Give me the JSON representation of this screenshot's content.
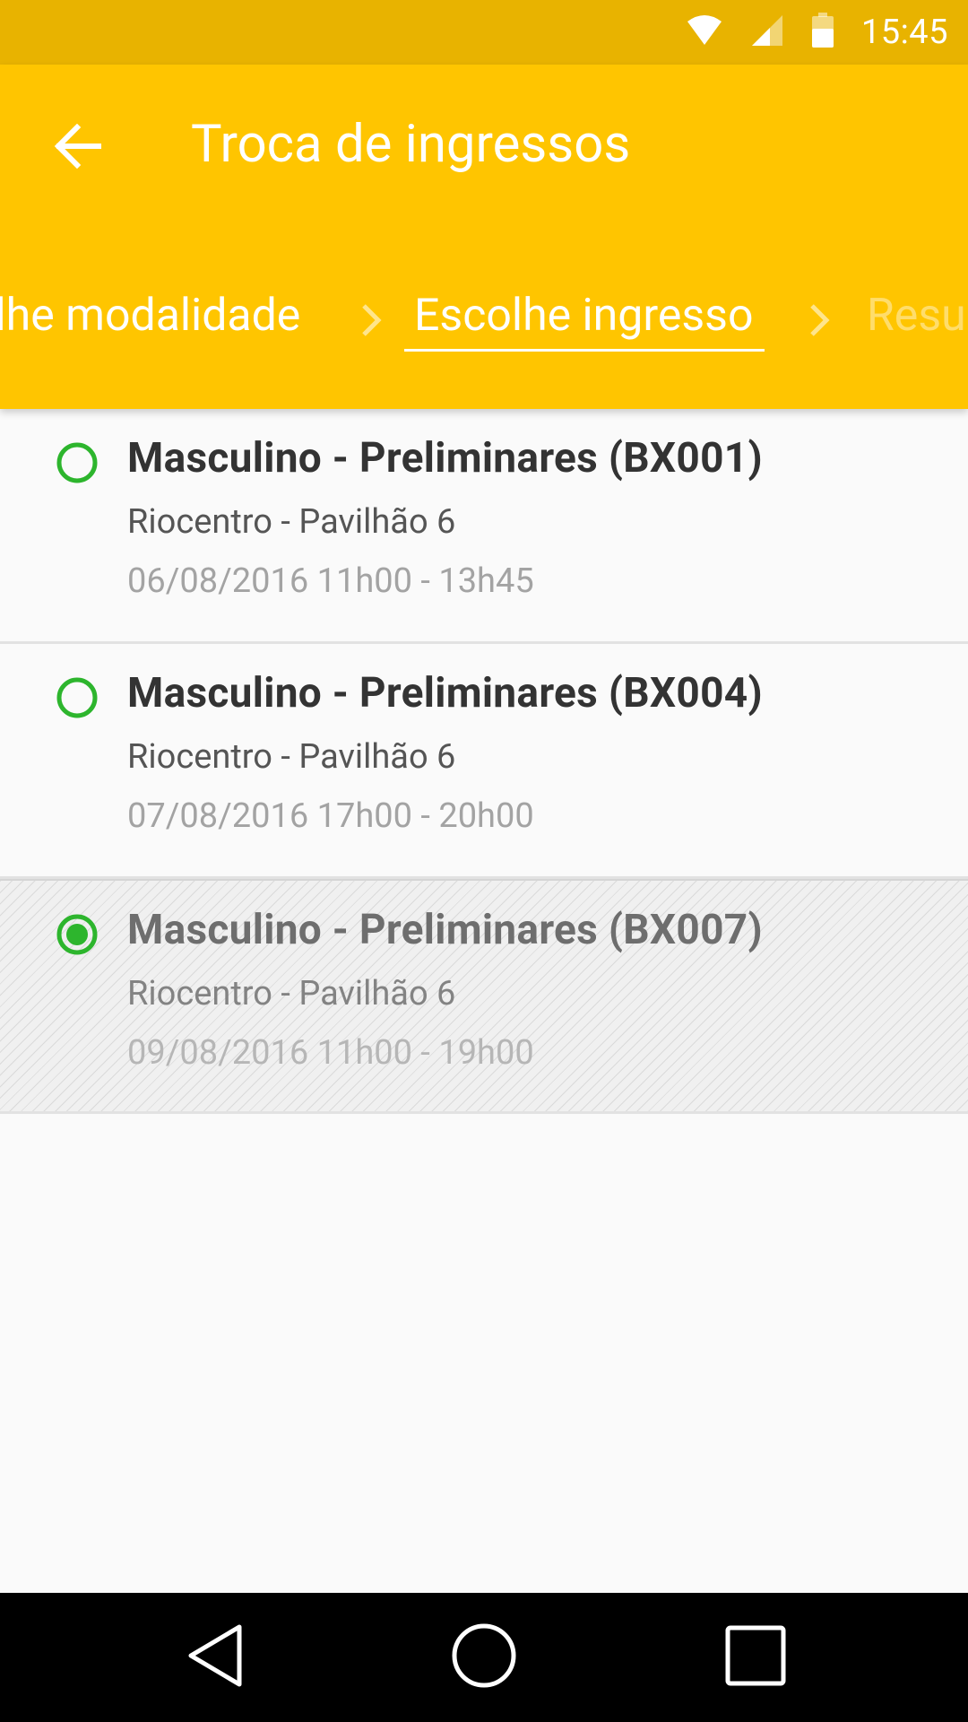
{
  "status_bar": {
    "time": "15:45",
    "icons": [
      "wifi-icon",
      "signal-icon",
      "battery-icon"
    ]
  },
  "app_bar": {
    "title": "Troca de ingressos",
    "back_icon": "arrow-back-icon"
  },
  "stepper": {
    "steps": [
      {
        "label": "Escolhe modalidade",
        "state": "done"
      },
      {
        "label": "Escolhe ingresso",
        "state": "active"
      },
      {
        "label": "Resumo",
        "state": "upcoming"
      }
    ],
    "visible_text": [
      "olhe modalidade",
      "Escolhe ingresso",
      "Resu"
    ]
  },
  "tickets": [
    {
      "title": "Masculino - Preliminares (BX001)",
      "venue": "Riocentro - Pavilhão 6",
      "time": "06/08/2016 11h00 - 13h45",
      "selected": false,
      "disabled": false
    },
    {
      "title": "Masculino - Preliminares (BX004)",
      "venue": "Riocentro - Pavilhão 6",
      "time": "07/08/2016 17h00 - 20h00",
      "selected": false,
      "disabled": false
    },
    {
      "title": "Masculino - Preliminares (BX007)",
      "venue": "Riocentro - Pavilhão 6",
      "time": "09/08/2016 11h00 - 19h00",
      "selected": true,
      "disabled": true
    }
  ],
  "colors": {
    "status_bar": "#e8b300",
    "app_bar": "#ffc500",
    "radio": "#2db52d",
    "background": "#fafafa"
  },
  "nav_bar": {
    "buttons": [
      "back-triangle-icon",
      "home-circle-icon",
      "recents-square-icon"
    ]
  }
}
